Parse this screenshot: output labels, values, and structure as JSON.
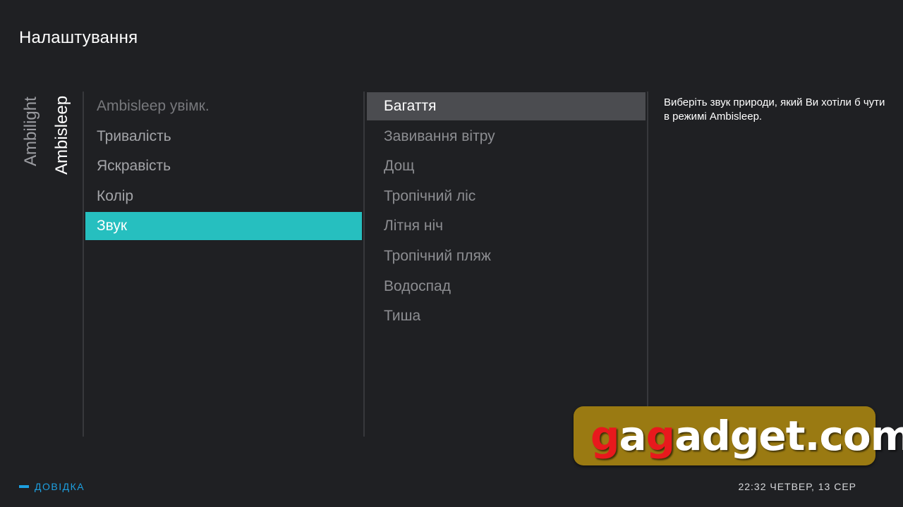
{
  "header": {
    "title": "Налаштування"
  },
  "tabs": [
    {
      "label": "Ambilight",
      "active": false
    },
    {
      "label": "Ambisleep",
      "active": true
    }
  ],
  "main_menu": {
    "items": [
      {
        "label": "Ambisleep увімк."
      },
      {
        "label": "Тривалість"
      },
      {
        "label": "Яскравість"
      },
      {
        "label": "Колір"
      },
      {
        "label": "Звук",
        "selected": true
      }
    ]
  },
  "sub_menu": {
    "items": [
      {
        "label": "Багаття",
        "selected": true
      },
      {
        "label": "Завивання вітру"
      },
      {
        "label": "Дощ"
      },
      {
        "label": "Тропічний ліс"
      },
      {
        "label": "Літня ніч"
      },
      {
        "label": "Тропічний пляж"
      },
      {
        "label": "Водоспад"
      },
      {
        "label": "Тиша"
      }
    ]
  },
  "help_panel": {
    "text": "Виберіть звук природи, який Ви хотіли б чути в режимі Ambisleep."
  },
  "footer": {
    "help_label": "ДОВІДКА",
    "clock": "22:32 ЧЕТВЕР, 13 СЕР"
  },
  "watermark": {
    "part1": "g",
    "part2": "a",
    "part3": "g",
    "part4": "adget.com"
  },
  "colors": {
    "background": "#1f2023",
    "accent_teal": "#26bfbf",
    "selected_grey": "#4b4c50",
    "help_blue": "#1d9fe0",
    "watermark_gold": "#9a7a12",
    "watermark_red": "#e8191d"
  }
}
